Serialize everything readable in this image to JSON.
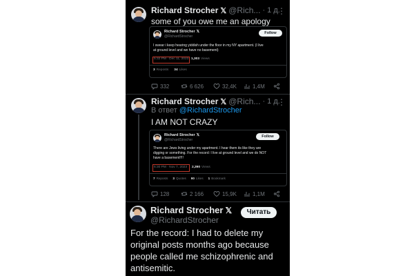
{
  "tweet1": {
    "name": "Richard Strocher",
    "handle": "@Rich...",
    "time": "· 1 д.",
    "text": "some of you owe me an apology",
    "quote": {
      "name": "Richard Strocher",
      "x_mark": "𝕏",
      "handle": "@RichardStrocher",
      "follow": "Follow",
      "text_lines": [
        "I swear i keep hearing yiddish under the floor in my NY apartment. (I live",
        "at ground level and we have no basement)"
      ],
      "timestamp": "5:32 PM · Dec 11, 2023",
      "views_count": "1,303",
      "views_label": "Views",
      "reposts_count": "3",
      "reposts_label": "Reposts",
      "likes_count": "34",
      "likes_label": "Likes"
    },
    "actions": {
      "reply": "332",
      "repost": "6 626",
      "like": "32,4K",
      "views": "1,4M"
    }
  },
  "tweet2": {
    "name": "Richard Strocher",
    "handle": "@Rich...",
    "time": "· 1 д.",
    "reply_prefix": "В ответ",
    "reply_to": "@RichardStrocher",
    "text": "I AM NOT CRAZY",
    "quote": {
      "name": "Richard Strocher",
      "x_mark": "𝕏",
      "handle": "@RichardStrocher",
      "follow": "Follow",
      "text_lines": [
        "There are Jews living under my apartment. I hear them its like they are",
        "digging or something. For the record: I live at ground level and we do NOT",
        "have a basement!!!!"
      ],
      "timestamp": "5:30 PM · Nov 7, 2023",
      "views_count": "2,390",
      "views_label": "Views",
      "reposts_count": "7",
      "reposts_label": "Reposts",
      "quotes_count": "3",
      "quotes_label": "Quotes",
      "likes_count": "90",
      "likes_label": "Likes",
      "bookmarks_count": "1",
      "bookmarks_label": "Bookmark"
    },
    "actions": {
      "reply": "128",
      "repost": "2 166",
      "like": "15,9K",
      "views": "1,1M"
    }
  },
  "tweet3": {
    "name": "Richard Strocher",
    "x_mark": "𝕏",
    "handle": "@RichardStrocher",
    "read_button": "Читать",
    "text_lines": [
      "For the record: I had to delete my",
      "original posts months ago because",
      "people called me schizophrenic and",
      "antisemitic."
    ]
  },
  "colors": {
    "background": "#000000",
    "text": "#e7e9ea",
    "muted": "#71767b",
    "link": "#1d9bf0",
    "highlight": "#c2392b"
  }
}
